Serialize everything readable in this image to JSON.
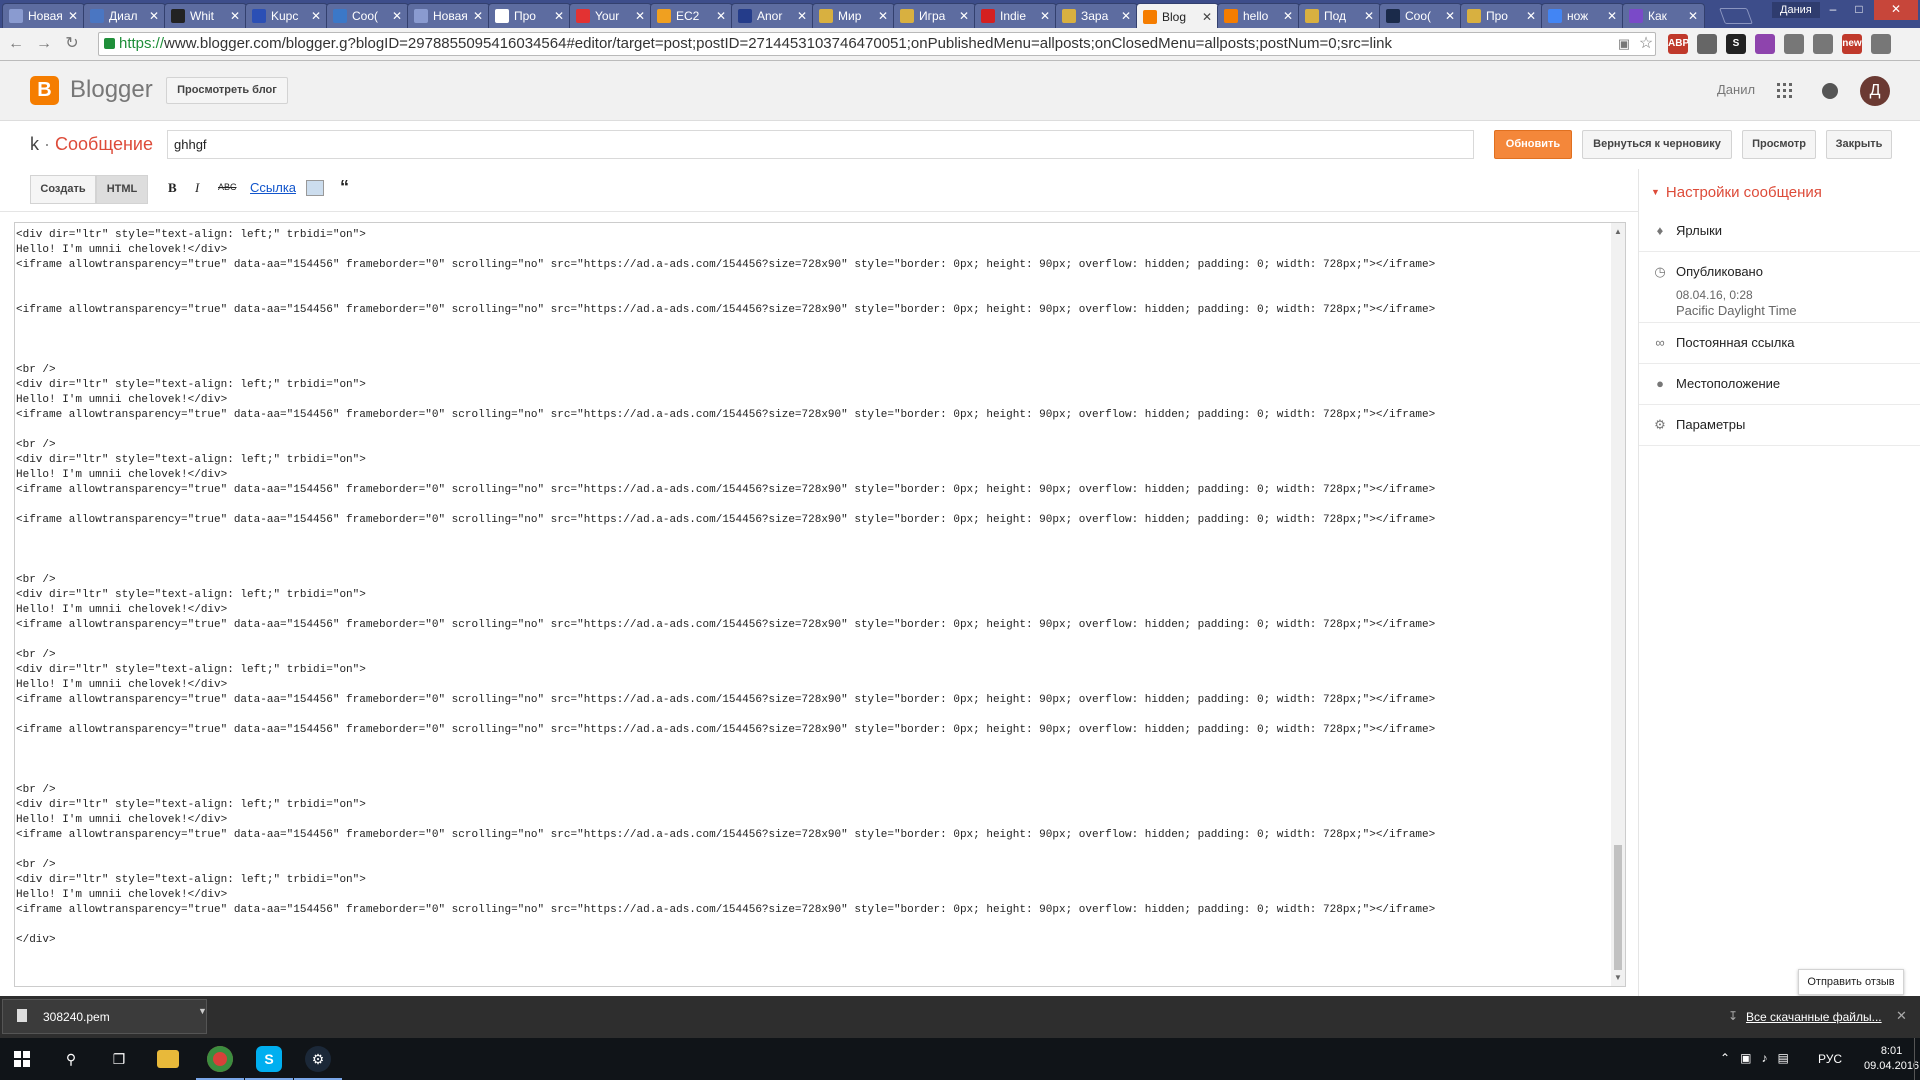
{
  "browser": {
    "tabs": [
      {
        "title": "Новая в",
        "color": "#8a9bd0",
        "icon": "blank-page-icon",
        "active": false
      },
      {
        "title": "Диал",
        "color": "#4a76c2",
        "icon": "chat-icon",
        "active": false
      },
      {
        "title": "Whit",
        "color": "#222222",
        "icon": "whitehat-icon",
        "active": false
      },
      {
        "title": "Kupc",
        "color": "#2b4fb5",
        "icon": "kupc-icon",
        "active": false
      },
      {
        "title": "Coo(",
        "color": "#3b78c8",
        "icon": "blogger-b-icon",
        "active": false
      },
      {
        "title": "Новая в",
        "color": "#8a9bd0",
        "icon": "blank-page-icon",
        "active": false
      },
      {
        "title": "Про",
        "color": "#ffffff",
        "icon": "profile-card-icon",
        "active": false
      },
      {
        "title": "Your",
        "color": "#e33232",
        "icon": "mail-icon",
        "active": false
      },
      {
        "title": "EC2",
        "color": "#f0a020",
        "icon": "aws-cube-icon",
        "active": false
      },
      {
        "title": "Anor",
        "color": "#243c8a",
        "icon": "anon-icon",
        "active": false
      },
      {
        "title": "Мир",
        "color": "#d8b040",
        "icon": "game-character-icon",
        "active": false
      },
      {
        "title": "Игра",
        "color": "#d8b040",
        "icon": "game-character-icon",
        "active": false
      },
      {
        "title": "Indie",
        "color": "#d42020",
        "icon": "indiegala-icon",
        "active": false
      },
      {
        "title": "Зара",
        "color": "#d8b040",
        "icon": "game-character-icon",
        "active": false
      },
      {
        "title": "Blog",
        "color": "#f57d00",
        "icon": "blogger-icon",
        "active": true
      },
      {
        "title": "hello",
        "color": "#f57d00",
        "icon": "blogger-icon",
        "active": false
      },
      {
        "title": "Под",
        "color": "#d8b040",
        "icon": "game-character-icon",
        "active": false
      },
      {
        "title": "Coo(",
        "color": "#1a2a4a",
        "icon": "steam-icon",
        "active": false
      },
      {
        "title": "Про",
        "color": "#d8b040",
        "icon": "game-character-icon",
        "active": false
      },
      {
        "title": "нож",
        "color": "#4285f4",
        "icon": "google-icon",
        "active": false
      },
      {
        "title": "Как",
        "color": "#7a4ac8",
        "icon": "yahoo-icon",
        "active": false
      }
    ],
    "window_user": "Дания",
    "url_scheme": "https://",
    "url_rest": "www.blogger.com/blogger.g?blogID=2978855095416034564#editor/target=post;postID=2714453103746470051;onPublishedMenu=allposts;onClosedMenu=allposts;postNum=0;src=link",
    "extensions": [
      {
        "icon": "adblock-plus-icon",
        "label": "ABP",
        "color": "#c0392b"
      },
      {
        "icon": "ghost-extension-icon",
        "label": "",
        "color": "#666666"
      },
      {
        "icon": "s-extension-icon",
        "label": "S",
        "color": "#222222"
      },
      {
        "icon": "colorful-extension-icon",
        "label": "",
        "color": "#8e44ad"
      },
      {
        "icon": "arrow-extension-icon",
        "label": "",
        "color": "#777777"
      },
      {
        "icon": "hand-extension-icon",
        "label": "",
        "color": "#777777"
      },
      {
        "icon": "new-extension-icon",
        "label": "new",
        "color": "#c0392b"
      },
      {
        "icon": "chrome-menu-icon",
        "label": "",
        "color": "#777777"
      }
    ]
  },
  "blogger": {
    "brand": "Blogger",
    "view_blog": "Просмотреть блог",
    "user_name": "Данил",
    "avatar_letter": "Д",
    "blog_letter": "k",
    "title_sep": "·",
    "post_type": "Сообщение",
    "post_title": "ghhgf",
    "update": "Обновить",
    "revert_draft": "Вернуться к черновику",
    "preview": "Просмотр",
    "close": "Закрыть"
  },
  "editor": {
    "compose": "Создать",
    "html": "HTML",
    "bold": "B",
    "italic": "I",
    "strike": "ABC",
    "link": "Ссылка",
    "content": "<br />\n<div dir=\"ltr\" style=\"text-align: left;\" trbidi=\"on\">\nHello! I'm umnii chelovek!</div>\n<iframe allowtransparency=\"true\" data-aa=\"154456\" frameborder=\"0\" scrolling=\"no\" src=\"https://ad.a-ads.com/154456?size=728x90\" style=\"border: 0px; height: 90px; overflow: hidden; padding: 0; width: 728px;\"></iframe>\n\n\n<iframe allowtransparency=\"true\" data-aa=\"154456\" frameborder=\"0\" scrolling=\"no\" src=\"https://ad.a-ads.com/154456?size=728x90\" style=\"border: 0px; height: 90px; overflow: hidden; padding: 0; width: 728px;\"></iframe>\n\n\n\n<br />\n<div dir=\"ltr\" style=\"text-align: left;\" trbidi=\"on\">\nHello! I'm umnii chelovek!</div>\n<iframe allowtransparency=\"true\" data-aa=\"154456\" frameborder=\"0\" scrolling=\"no\" src=\"https://ad.a-ads.com/154456?size=728x90\" style=\"border: 0px; height: 90px; overflow: hidden; padding: 0; width: 728px;\"></iframe>\n\n<br />\n<div dir=\"ltr\" style=\"text-align: left;\" trbidi=\"on\">\nHello! I'm umnii chelovek!</div>\n<iframe allowtransparency=\"true\" data-aa=\"154456\" frameborder=\"0\" scrolling=\"no\" src=\"https://ad.a-ads.com/154456?size=728x90\" style=\"border: 0px; height: 90px; overflow: hidden; padding: 0; width: 728px;\"></iframe>\n\n<iframe allowtransparency=\"true\" data-aa=\"154456\" frameborder=\"0\" scrolling=\"no\" src=\"https://ad.a-ads.com/154456?size=728x90\" style=\"border: 0px; height: 90px; overflow: hidden; padding: 0; width: 728px;\"></iframe>\n\n\n\n<br />\n<div dir=\"ltr\" style=\"text-align: left;\" trbidi=\"on\">\nHello! I'm umnii chelovek!</div>\n<iframe allowtransparency=\"true\" data-aa=\"154456\" frameborder=\"0\" scrolling=\"no\" src=\"https://ad.a-ads.com/154456?size=728x90\" style=\"border: 0px; height: 90px; overflow: hidden; padding: 0; width: 728px;\"></iframe>\n\n<br />\n<div dir=\"ltr\" style=\"text-align: left;\" trbidi=\"on\">\nHello! I'm umnii chelovek!</div>\n<iframe allowtransparency=\"true\" data-aa=\"154456\" frameborder=\"0\" scrolling=\"no\" src=\"https://ad.a-ads.com/154456?size=728x90\" style=\"border: 0px; height: 90px; overflow: hidden; padding: 0; width: 728px;\"></iframe>\n\n<iframe allowtransparency=\"true\" data-aa=\"154456\" frameborder=\"0\" scrolling=\"no\" src=\"https://ad.a-ads.com/154456?size=728x90\" style=\"border: 0px; height: 90px; overflow: hidden; padding: 0; width: 728px;\"></iframe>\n\n\n\n<br />\n<div dir=\"ltr\" style=\"text-align: left;\" trbidi=\"on\">\nHello! I'm umnii chelovek!</div>\n<iframe allowtransparency=\"true\" data-aa=\"154456\" frameborder=\"0\" scrolling=\"no\" src=\"https://ad.a-ads.com/154456?size=728x90\" style=\"border: 0px; height: 90px; overflow: hidden; padding: 0; width: 728px;\"></iframe>\n\n<br />\n<div dir=\"ltr\" style=\"text-align: left;\" trbidi=\"on\">\nHello! I'm umnii chelovek!</div>\n<iframe allowtransparency=\"true\" data-aa=\"154456\" frameborder=\"0\" scrolling=\"no\" src=\"https://ad.a-ads.com/154456?size=728x90\" style=\"border: 0px; height: 90px; overflow: hidden; padding: 0; width: 728px;\"></iframe>\n\n</div>"
  },
  "sidebar": {
    "header": "Настройки сообщения",
    "labels": "Ярлыки",
    "published": "Опубликовано",
    "published_date": "08.04.16, 0:28",
    "published_tz": "Pacific Daylight Time",
    "permalink": "Постоянная ссылка",
    "location": "Местоположение",
    "options": "Параметры",
    "feedback": "Отправить отзыв"
  },
  "downloads": {
    "file": "308240.pem",
    "show_all": "Все скачанные файлы..."
  },
  "taskbar": {
    "lang": "РУС",
    "time": "8:01",
    "date": "09.04.2016"
  }
}
